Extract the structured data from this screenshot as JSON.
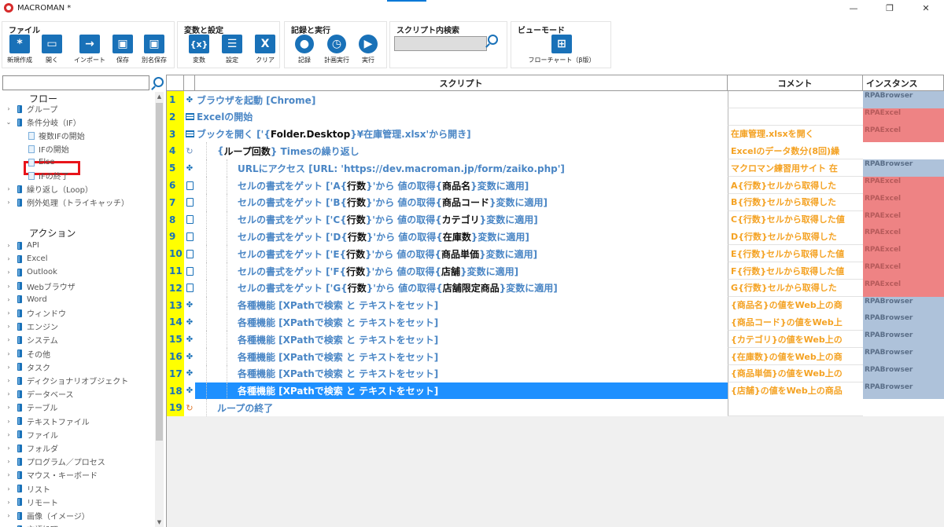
{
  "window": {
    "title": "MACROMAN *",
    "minimize": "—",
    "maximize": "❐",
    "close": "✕"
  },
  "toolbar": {
    "file": {
      "title": "ファイル",
      "buttons": [
        {
          "label": "新規作成",
          "icon": "asterisk-icon",
          "glyph": "*"
        },
        {
          "label": "開く",
          "icon": "folder-icon",
          "glyph": "▭"
        },
        {
          "label": "インポート",
          "icon": "import-arrow-icon",
          "glyph": "→"
        },
        {
          "label": "保存",
          "icon": "save-icon",
          "glyph": "▣"
        },
        {
          "label": "別名保存",
          "icon": "save-as-icon",
          "glyph": "▣"
        }
      ]
    },
    "variables": {
      "title": "変数と設定",
      "buttons": [
        {
          "label": "変数",
          "icon": "variable-icon",
          "glyph": "{x}"
        },
        {
          "label": "設定",
          "icon": "settings-list-icon",
          "glyph": "☰"
        },
        {
          "label": "クリア",
          "icon": "clear-x-icon",
          "glyph": "X"
        }
      ]
    },
    "record": {
      "title": "記録と実行",
      "buttons": [
        {
          "label": "記録",
          "icon": "record-icon",
          "glyph": "●"
        },
        {
          "label": "計画実行",
          "icon": "schedule-icon",
          "glyph": "◷"
        },
        {
          "label": "実行",
          "icon": "play-icon",
          "glyph": "▶"
        }
      ]
    },
    "search": {
      "title": "スクリプト内検索",
      "value": ""
    },
    "view": {
      "title": "ビューモード",
      "button": {
        "label": "フローチャート（β版）",
        "icon": "flowchart-icon",
        "glyph": "⊞"
      }
    }
  },
  "sidebar": {
    "search_value": "",
    "flow_heading": "フロー",
    "action_heading": "アクション",
    "flow_items": [
      {
        "label": "グループ",
        "level": 0,
        "toggle": "›"
      },
      {
        "label": "条件分岐（IF）",
        "level": 0,
        "toggle": "⌄"
      },
      {
        "label": "複数IFの開始",
        "level": 1,
        "toggle": ""
      },
      {
        "label": "IFの開始",
        "level": 1,
        "toggle": ""
      },
      {
        "label": "Else",
        "level": 1,
        "toggle": ""
      },
      {
        "label": "IFの終了",
        "level": 1,
        "toggle": ""
      },
      {
        "label": "繰り返し（Loop）",
        "level": 0,
        "toggle": "›"
      },
      {
        "label": "例外処理（トライキャッチ）",
        "level": 0,
        "toggle": "›"
      }
    ],
    "action_items": [
      "API",
      "Excel",
      "Outlook",
      "Webブラウザ",
      "Word",
      "ウィンドウ",
      "エンジン",
      "システム",
      "その他",
      "タスク",
      "ディクショナリオブジェクト",
      "データベース",
      "テーブル",
      "テキストファイル",
      "ファイル",
      "フォルダ",
      "プログラム／プロセス",
      "マウス・キーボード",
      "リスト",
      "リモート",
      "画像（イメージ）",
      "言語処理"
    ]
  },
  "grid": {
    "headers": {
      "script": "スクリプト",
      "comment": "コメント",
      "instance": "インスタンス"
    },
    "rows": [
      {
        "num": "1",
        "icon": "robot-icon",
        "indent": 0,
        "parts": [
          {
            "t": "ブラウザを起動 [Chrome]"
          }
        ],
        "comment": "",
        "instance": "RPABrowser",
        "inst_type": "browser"
      },
      {
        "num": "2",
        "icon": "table-icon",
        "indent": 0,
        "parts": [
          {
            "t": "Excelの開始"
          }
        ],
        "comment": "",
        "instance": "RPAExcel",
        "inst_type": "excel"
      },
      {
        "num": "3",
        "icon": "table-icon",
        "indent": 0,
        "parts": [
          {
            "t": "ブックを開く ['{"
          },
          {
            "t": "Folder.Desktop",
            "k": 1
          },
          {
            "t": "}¥在庫管理.xlsx'から開き]"
          }
        ],
        "comment": "在庫管理.xlsxを開く",
        "instance": "RPAExcel",
        "inst_type": "excel"
      },
      {
        "num": "4",
        "icon": "loop-icon",
        "indent": 1,
        "parts": [
          {
            "t": "{"
          },
          {
            "t": "ループ回数",
            "k": 1
          },
          {
            "t": "} Timesの繰り返し"
          }
        ],
        "comment": "Excelのデータ数分(8回)繰",
        "instance": "",
        "inst_type": "none"
      },
      {
        "num": "5",
        "icon": "robot-icon",
        "indent": 2,
        "parts": [
          {
            "t": "URLにアクセス [URL: 'https://dev.macroman.jp/form/zaiko.php']"
          }
        ],
        "comment": "マクロマン練習用サイト 在",
        "instance": "RPABrowser",
        "inst_type": "browser"
      },
      {
        "num": "6",
        "icon": "doc-icon",
        "indent": 2,
        "parts": [
          {
            "t": "セルの書式をゲット ['A{"
          },
          {
            "t": "行数",
            "k": 1
          },
          {
            "t": "}'から 値の取得{"
          },
          {
            "t": "商品名",
            "k": 1
          },
          {
            "t": "}変数に適用]"
          }
        ],
        "comment": "A{行数}セルから取得した",
        "instance": "RPAExcel",
        "inst_type": "excel"
      },
      {
        "num": "7",
        "icon": "doc-icon",
        "indent": 2,
        "parts": [
          {
            "t": "セルの書式をゲット ['B{"
          },
          {
            "t": "行数",
            "k": 1
          },
          {
            "t": "}'から 値の取得{"
          },
          {
            "t": "商品コード",
            "k": 1
          },
          {
            "t": "}変数に適用]"
          }
        ],
        "comment": "B{行数}セルから取得した",
        "instance": "RPAExcel",
        "inst_type": "excel"
      },
      {
        "num": "8",
        "icon": "doc-icon",
        "indent": 2,
        "parts": [
          {
            "t": "セルの書式をゲット ['C{"
          },
          {
            "t": "行数",
            "k": 1
          },
          {
            "t": "}'から 値の取得{"
          },
          {
            "t": "カテゴリ",
            "k": 1
          },
          {
            "t": "}変数に適用]"
          }
        ],
        "comment": "C{行数}セルから取得した値",
        "instance": "RPAExcel",
        "inst_type": "excel"
      },
      {
        "num": "9",
        "icon": "doc-icon",
        "indent": 2,
        "parts": [
          {
            "t": "セルの書式をゲット ['D{"
          },
          {
            "t": "行数",
            "k": 1
          },
          {
            "t": "}'から 値の取得{"
          },
          {
            "t": "在庫数",
            "k": 1
          },
          {
            "t": "}変数に適用]"
          }
        ],
        "comment": "D{行数}セルから取得した",
        "instance": "RPAExcel",
        "inst_type": "excel"
      },
      {
        "num": "10",
        "icon": "doc-icon",
        "indent": 2,
        "parts": [
          {
            "t": "セルの書式をゲット ['E{"
          },
          {
            "t": "行数",
            "k": 1
          },
          {
            "t": "}'から 値の取得{"
          },
          {
            "t": "商品単価",
            "k": 1
          },
          {
            "t": "}変数に適用]"
          }
        ],
        "comment": "E{行数}セルから取得した値",
        "instance": "RPAExcel",
        "inst_type": "excel"
      },
      {
        "num": "11",
        "icon": "doc-icon",
        "indent": 2,
        "parts": [
          {
            "t": "セルの書式をゲット ['F{"
          },
          {
            "t": "行数",
            "k": 1
          },
          {
            "t": "}'から 値の取得{"
          },
          {
            "t": "店舗",
            "k": 1
          },
          {
            "t": "}変数に適用]"
          }
        ],
        "comment": "F{行数}セルから取得した値",
        "instance": "RPAExcel",
        "inst_type": "excel"
      },
      {
        "num": "12",
        "icon": "doc-icon",
        "indent": 2,
        "parts": [
          {
            "t": "セルの書式をゲット ['G{"
          },
          {
            "t": "行数",
            "k": 1
          },
          {
            "t": "}'から 値の取得{"
          },
          {
            "t": "店舗限定商品",
            "k": 1
          },
          {
            "t": "}変数に適用]"
          }
        ],
        "comment": "G{行数}セルから取得した",
        "instance": "RPAExcel",
        "inst_type": "excel"
      },
      {
        "num": "13",
        "icon": "robot-icon",
        "indent": 2,
        "parts": [
          {
            "t": "各種機能 [XPathで検索 と テキストをセット]"
          }
        ],
        "comment": "{商品名}の値をWeb上の商",
        "instance": "RPABrowser",
        "inst_type": "browser"
      },
      {
        "num": "14",
        "icon": "robot-icon",
        "indent": 2,
        "parts": [
          {
            "t": "各種機能 [XPathで検索 と テキストをセット]"
          }
        ],
        "comment": "{商品コード}の値をWeb上",
        "instance": "RPABrowser",
        "inst_type": "browser"
      },
      {
        "num": "15",
        "icon": "robot-icon",
        "indent": 2,
        "parts": [
          {
            "t": "各種機能 [XPathで検索 と テキストをセット]"
          }
        ],
        "comment": "{カテゴリ}の値をWeb上の",
        "instance": "RPABrowser",
        "inst_type": "browser"
      },
      {
        "num": "16",
        "icon": "robot-icon",
        "indent": 2,
        "parts": [
          {
            "t": "各種機能 [XPathで検索 と テキストをセット]"
          }
        ],
        "comment": "{在庫数}の値をWeb上の商",
        "instance": "RPABrowser",
        "inst_type": "browser"
      },
      {
        "num": "17",
        "icon": "robot-icon",
        "indent": 2,
        "parts": [
          {
            "t": "各種機能 [XPathで検索 と テキストをセット]"
          }
        ],
        "comment": "{商品単価}の値をWeb上の",
        "instance": "RPABrowser",
        "inst_type": "browser"
      },
      {
        "num": "18",
        "icon": "robot-icon",
        "indent": 2,
        "parts": [
          {
            "t": "各種機能 [XPathで検索 と テキストをセット]"
          }
        ],
        "comment": "{店舗}の値をWeb上の商品",
        "instance": "RPABrowser",
        "inst_type": "browser",
        "selected": true
      },
      {
        "num": "19",
        "icon": "loop-end-icon",
        "indent": 1,
        "parts": [
          {
            "t": "ループの終了"
          }
        ],
        "comment": "",
        "instance": "",
        "inst_type": "none"
      }
    ]
  },
  "colors": {
    "accent": "#1971b8",
    "row_number_bg": "#ffff00",
    "comment_text": "#f4a223",
    "selected_row": "#1e90ff",
    "instance_browser": "#aec2da",
    "instance_excel": "#ee8384"
  }
}
